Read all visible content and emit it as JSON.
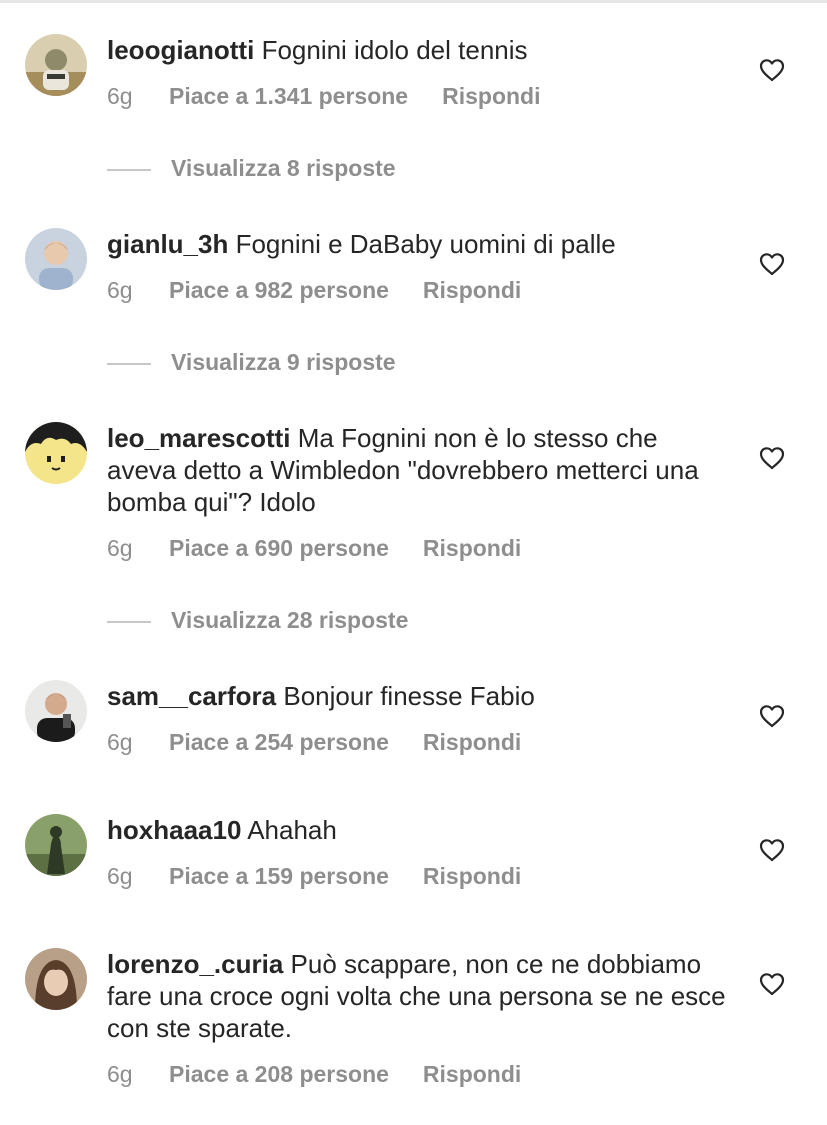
{
  "comments": [
    {
      "username": "leoogianotti",
      "text": "Fognini idolo del tennis",
      "time": "6g",
      "likes": "Piace a 1.341 persone",
      "reply": "Rispondi",
      "view_replies": "Visualizza 8 risposte"
    },
    {
      "username": "gianlu_3h",
      "text": "Fognini e DaBaby uomini di palle",
      "time": "6g",
      "likes": "Piace a 982 persone",
      "reply": "Rispondi",
      "view_replies": "Visualizza 9 risposte"
    },
    {
      "username": "leo_marescotti",
      "text": "Ma Fognini non è lo stesso che aveva detto a Wimbledon \"dovrebbero metterci una bomba qui\"? Idolo",
      "time": "6g",
      "likes": "Piace a 690 persone",
      "reply": "Rispondi",
      "view_replies": "Visualizza 28 risposte"
    },
    {
      "username": "sam__carfora",
      "text": "Bonjour finesse Fabio",
      "time": "6g",
      "likes": "Piace a 254 persone",
      "reply": "Rispondi"
    },
    {
      "username": "hoxhaaa10",
      "text": "Ahahah",
      "time": "6g",
      "likes": "Piace a 159 persone",
      "reply": "Rispondi"
    },
    {
      "username": "lorenzo_.curia",
      "text": "Può scappare, non ce ne dobbiamo fare una croce ogni volta che una persona se ne esce con ste sparate.",
      "time": "6g",
      "likes": "Piace a 208 persone",
      "reply": "Rispondi"
    }
  ],
  "icons": {
    "like": "heart-outline-icon"
  },
  "colors": {
    "text": "#262626",
    "secondary": "#8e8e8e",
    "divider": "#c7c7c7"
  }
}
